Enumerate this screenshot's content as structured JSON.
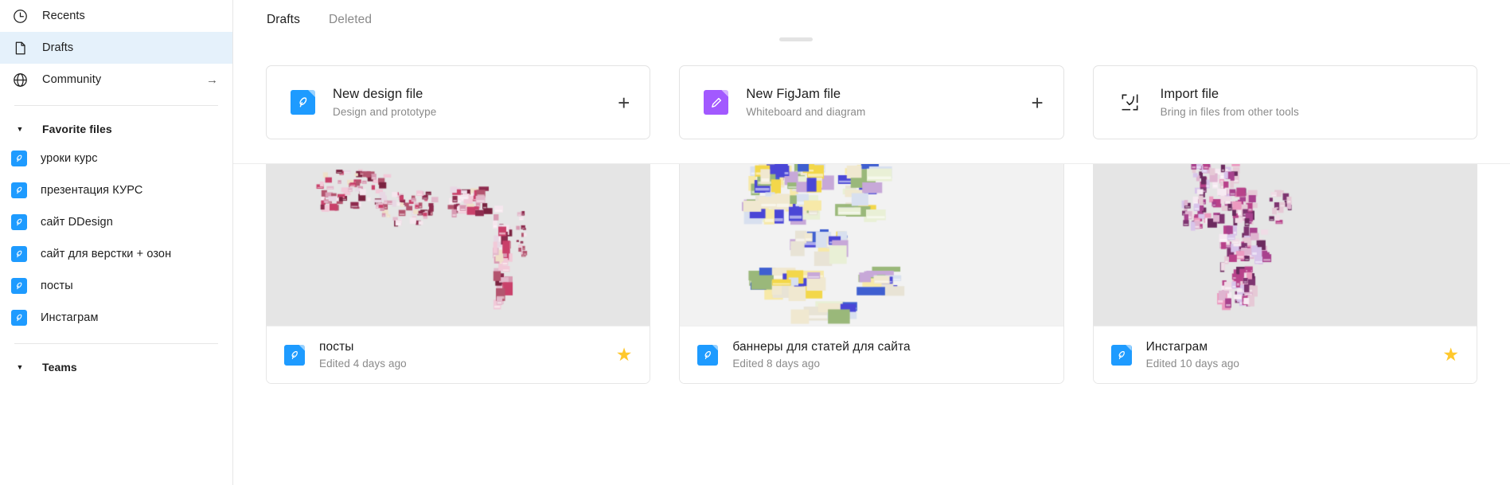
{
  "sidebar": {
    "nav": [
      {
        "label": "Recents",
        "icon": "clock-icon",
        "active": false,
        "arrow": ""
      },
      {
        "label": "Drafts",
        "icon": "file-icon",
        "active": true,
        "arrow": ""
      },
      {
        "label": "Community",
        "icon": "globe-icon",
        "active": false,
        "arrow": "→"
      }
    ],
    "favorites": {
      "title": "Favorite files",
      "caret": "▼",
      "items": [
        {
          "label": "уроки курс"
        },
        {
          "label": "презентация КУРС"
        },
        {
          "label": "сайт DDesign"
        },
        {
          "label": "сайт для верстки + озон"
        },
        {
          "label": "посты"
        },
        {
          "label": "Инстаграм"
        }
      ]
    },
    "teams": {
      "title": "Teams",
      "caret": "▼"
    }
  },
  "main": {
    "tabs": [
      {
        "label": "Drafts",
        "active": true
      },
      {
        "label": "Deleted",
        "active": false
      }
    ],
    "action_cards": [
      {
        "title": "New design file",
        "subtitle": "Design and prototype",
        "icon": "figma-design-file-icon",
        "action_icon": "plus-icon",
        "action_label": "+",
        "color": "#1e9bff"
      },
      {
        "title": "New FigJam file",
        "subtitle": "Whiteboard and diagram",
        "icon": "figjam-file-icon",
        "action_icon": "plus-icon",
        "action_label": "+",
        "color": "#a259ff"
      },
      {
        "title": "Import file",
        "subtitle": "Bring in files from other tools",
        "icon": "import-icon",
        "action_icon": "",
        "action_label": "",
        "color": "#1e1e1e"
      }
    ],
    "files": [
      {
        "title": "посты",
        "edited": "Edited 4 days ago",
        "favorite": true,
        "star": "★",
        "icon": "figma-design-file-icon"
      },
      {
        "title": "баннеры для статей для сайта",
        "edited": "Edited 8 days ago",
        "favorite": false,
        "star": "★",
        "icon": "figma-design-file-icon"
      },
      {
        "title": "Инстаграм",
        "edited": "Edited 10 days ago",
        "favorite": true,
        "star": "★",
        "icon": "figma-design-file-icon"
      }
    ]
  },
  "colors": {
    "accent_blue": "#1e9bff",
    "figjam_purple": "#a259ff",
    "star_gold": "#ffc82c",
    "active_row": "#e5f1fb",
    "thumb_gray": "#e5e5e5"
  }
}
